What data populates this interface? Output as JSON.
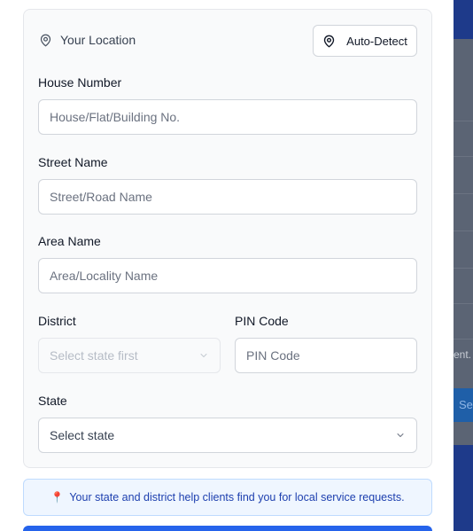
{
  "location": {
    "heading": "Your Location",
    "auto_detect_label": "Auto-Detect"
  },
  "form": {
    "house": {
      "label": "House Number",
      "placeholder": "House/Flat/Building No."
    },
    "street": {
      "label": "Street Name",
      "placeholder": "Street/Road Name"
    },
    "area": {
      "label": "Area Name",
      "placeholder": "Area/Locality Name"
    },
    "district": {
      "label": "District",
      "selected": "Select state first"
    },
    "pin": {
      "label": "PIN Code",
      "placeholder": "PIN Code"
    },
    "state": {
      "label": "State",
      "selected": "Select state"
    }
  },
  "info": {
    "icon": "📍",
    "text": "Your state and district help clients find you for local service requests."
  },
  "background": {
    "partial_text": "ent.",
    "partial_button": "Se"
  },
  "colors": {
    "accent": "#2563eb",
    "info_bg": "#eff6ff",
    "info_text": "#1e40af"
  }
}
